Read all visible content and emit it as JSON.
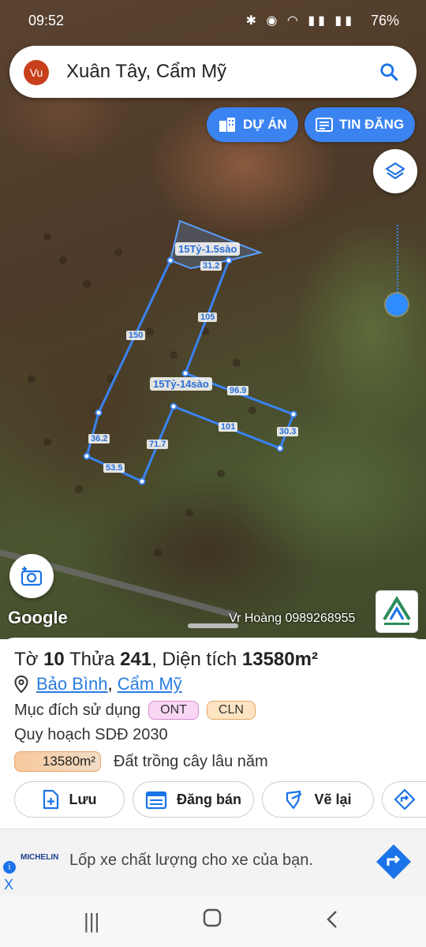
{
  "status_bar": {
    "time": "09:52",
    "battery": "76%"
  },
  "search": {
    "avatar": "Vu",
    "query": "Xuân Tây, Cẩm Mỹ",
    "icon": "search-icon"
  },
  "chips": {
    "projects": "DỰ ÁN",
    "listings": "TIN ĐĂNG"
  },
  "map": {
    "parcel_labels": [
      "15Tỷ-1.5sào",
      "15Tỷ-14sào"
    ],
    "edge_lengths": [
      "31.2",
      "150",
      "105",
      "96.9",
      "101",
      "30.3",
      "36.2",
      "71.7",
      "53.5"
    ],
    "attribution": "Google",
    "watermark": "Vr Hoàng 0989268955"
  },
  "parcel": {
    "title_prefix": "Tờ",
    "sheet_no": "10",
    "parcel_word": "Thửa",
    "parcel_no": "241",
    "area_word": ", Diện tích",
    "area": "13580m²",
    "ward": "Bảo Bình",
    "sep": ",",
    "district": "Cẩm Mỹ",
    "purpose_label": "Mục đích sử dụng",
    "purpose_tags": [
      {
        "label": "ONT",
        "color": "#f8d6f4",
        "border": "#d58ad0"
      },
      {
        "label": "CLN",
        "color": "#fde3c2",
        "border": "#e6a764"
      }
    ],
    "plan_label": "Quy hoạch SDĐ 2030",
    "plan_area": "13580m²",
    "plan_desc": "Đất trồng cây lâu năm"
  },
  "actions": {
    "save": "Lưu",
    "post": "Đăng bán",
    "redraw": "Vẽ lại"
  },
  "ad": {
    "brand": "MICHELIN",
    "text": "Lốp xe chất lượng cho xe của bạn.",
    "info": "i",
    "close": "X"
  },
  "accent": "#3a83f1"
}
